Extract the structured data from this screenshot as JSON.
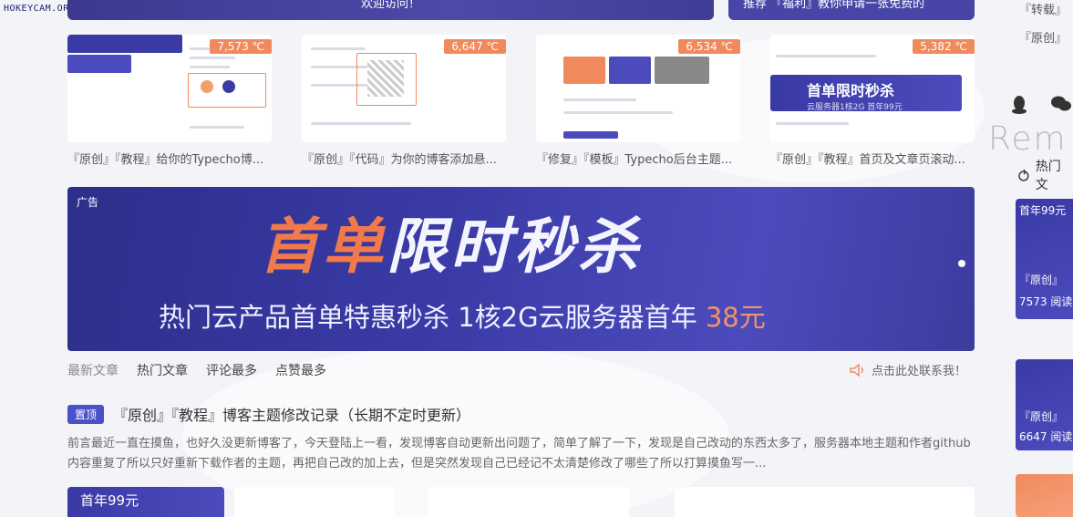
{
  "watermark": "HOKEYCAM.ORG",
  "top_banner": {
    "text": "欢迎访问！"
  },
  "top_recommend": {
    "text": "推荐 『福利』教你申请一张免费的"
  },
  "cards": [
    {
      "temp": "7,573 ℃",
      "title": "『原创』『教程』给你的Typecho博..."
    },
    {
      "temp": "6,647 ℃",
      "title": "『原创』『代码』为你的博客添加悬..."
    },
    {
      "temp": "6,534 ℃",
      "title": "『修复』『模板』Typecho后台主题..."
    },
    {
      "temp": "5,382 ℃",
      "title": "『原创』『教程』首页及文章页滚动...",
      "banner_text": "首单限时秒杀",
      "banner_sub": "云服务器1核2G 首年99元"
    }
  ],
  "ad": {
    "label": "广告",
    "headline_a": "首单",
    "headline_b": "限时秒杀",
    "sub_text": "热门云产品首单特惠秒杀  1核2G云服务器首年 ",
    "price": "38元"
  },
  "tabs": [
    {
      "label": "最新文章",
      "active": true
    },
    {
      "label": "热门文章",
      "active": false
    },
    {
      "label": "评论最多",
      "active": false
    },
    {
      "label": "点赞最多",
      "active": false
    }
  ],
  "contact": {
    "label": "点击此处联系我！"
  },
  "pinned_post": {
    "badge": "置顶",
    "title": "『原创』『教程』博客主题修改记录（长期不定时更新）",
    "excerpt": "前言最近一直在摸鱼，也好久没更新博客了，今天登陆上一看，发现博客自动更新出问题了，简单了解了一下，发现是自己改动的东西太多了，服务器本地主题和作者github内容重复了所以只好重新下载作者的主题，再把自己改的加上去，但是突然发现自己已经记不太清楚修改了哪些了所以打算摸鱼写一..."
  },
  "bottom_thumb": {
    "text": "首年99元"
  },
  "sidebar": {
    "tags": [
      "『转载』",
      "『原创』"
    ],
    "logo": "Rem",
    "hot_label": "热门文",
    "cards": [
      {
        "top": "首年99元",
        "label": "『原创』",
        "meta": "7573 阅读"
      },
      {
        "label": "『原创』",
        "meta": "6647 阅读"
      }
    ]
  },
  "colors": {
    "accent": "#4b52c8",
    "banner": "#3a3aa6",
    "orange": "#f08a5d"
  }
}
